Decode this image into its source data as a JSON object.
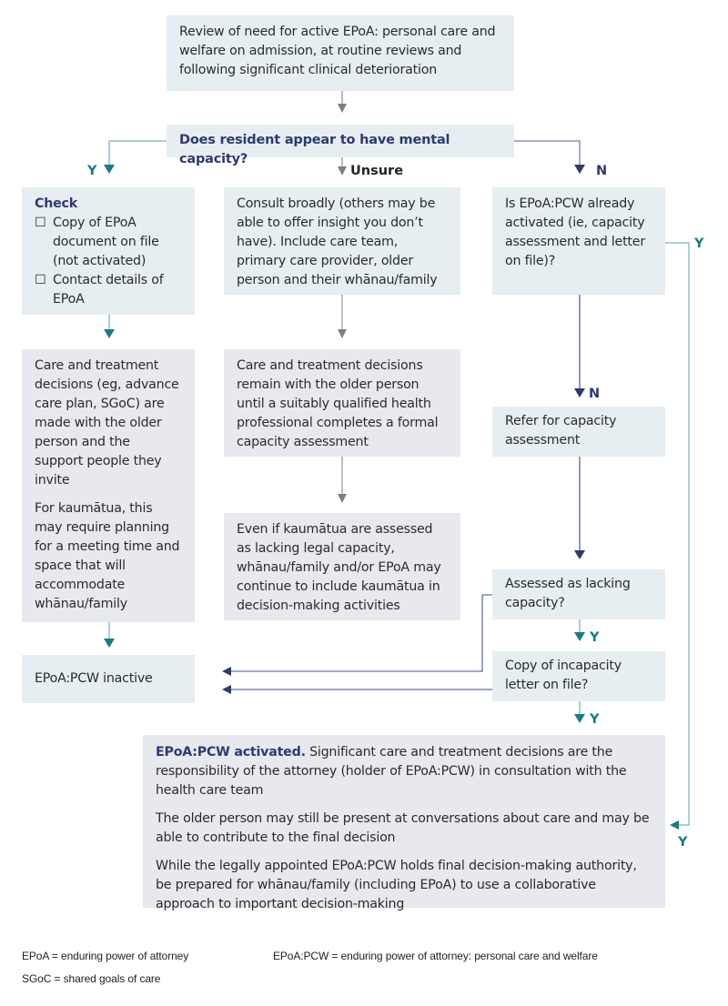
{
  "flowchart": {
    "start": "Review of need for active EPoA: personal care and welfare on admission, at routine reviews and following significant clinical deterioration",
    "question": "Does resident appear to have mental capacity?",
    "branch_labels": {
      "yes": "Y",
      "unsure": "Unsure",
      "no": "N",
      "already_activated_yes": "Y",
      "refer_no": "N",
      "lacking_yes": "Y",
      "letter_yes": "Y",
      "activated_yes": "Y"
    },
    "yes_column": {
      "check_title": "Check",
      "checklist": [
        {
          "checkbox": "☐",
          "text": "Copy of EPoA document on file (not activated)"
        },
        {
          "checkbox": "☐",
          "text": "Contact details of EPoA"
        }
      ],
      "decisions_paragraphs": [
        "Care and treatment decisions (eg, advance care plan, SGoC) are made with the older person and the support people they invite",
        "For kaumātua, this may require planning for a meeting time and space that will accommodate whānau/family"
      ],
      "inactive": "EPoA:PCW inactive"
    },
    "unsure_column": {
      "consult": "Consult broadly (others may be able to offer insight you don’t have). Include care team, primary care provider, older person and their whānau/family",
      "remain": "Care and treatment decisions remain with the older person until a suitably qualified health professional completes a formal capacity assessment",
      "kaumatua": "Even if kaumātua are assessed as lacking legal capacity, whānau/family and/or EPoA may continue to include kaumātua in decision-making activities"
    },
    "no_column": {
      "already_activated": "Is EPoA:PCW already activated (ie, capacity assessment and letter on file)?",
      "refer": "Refer for capacity assessment",
      "lacking": "Assessed as lacking capacity?",
      "letter": "Copy of incapacity letter on file?"
    },
    "activated": {
      "title": "EPoA:PCW activated.",
      "first_paragraph_rest": " Significant care and treatment decisions are the responsibility of the attorney (holder of EPoA:PCW) in consultation with the health care team",
      "paragraphs": [
        "The older person may still be present at conversations about care and may be able to contribute to the final decision",
        "While the legally appointed EPoA:PCW holds final decision-making authority, be prepared for whānau/family (including EPoA) to use a collaborative approach to important decision-making"
      ]
    }
  },
  "legend": {
    "epoa": "EPoA = enduring power of attorney",
    "epoa_pcw": "EPoA:PCW = enduring power of attorney: personal care and welfare",
    "sgoc": "SGoC = shared goals of care"
  },
  "colors": {
    "box_blue": "#e6eef1",
    "box_grey": "#e8e9ee",
    "teal_arrow": "#1a7a86",
    "teal_line": "#8fbfc6",
    "navy": "#2e3a6e",
    "grey_arrow": "#7f7f7f"
  }
}
